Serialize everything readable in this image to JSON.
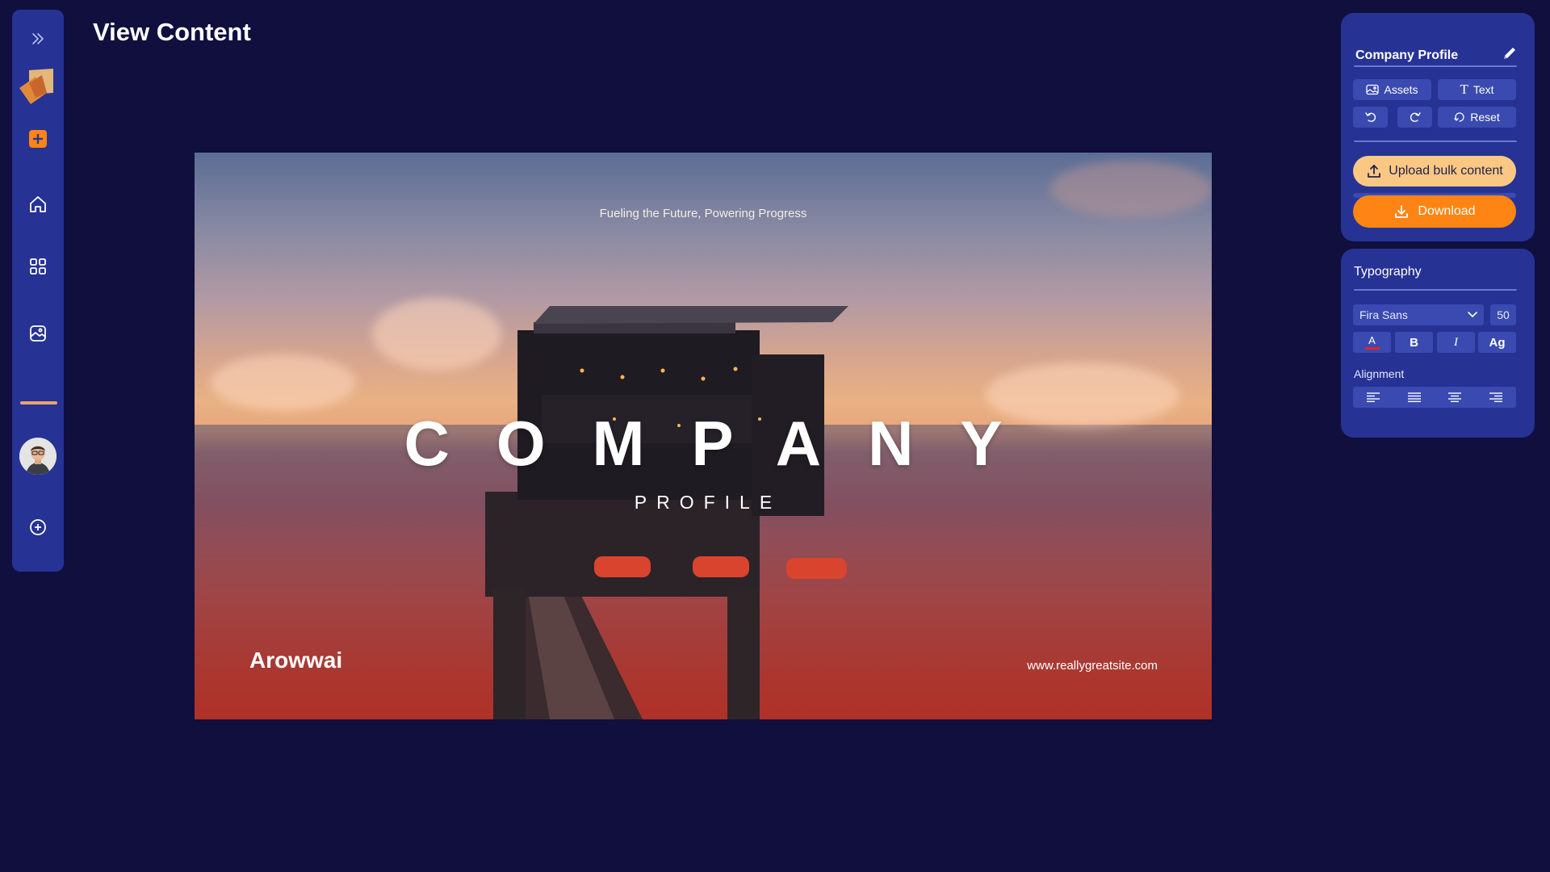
{
  "page": {
    "title": "View Content"
  },
  "sidebar": {
    "items": [
      {
        "name": "expand",
        "icon": "double-chevron-right-icon"
      },
      {
        "name": "logo",
        "icon": "app-logo"
      },
      {
        "name": "add",
        "icon": "plus-square-icon"
      },
      {
        "name": "home",
        "icon": "home-icon"
      },
      {
        "name": "dashboard",
        "icon": "grid-icon"
      },
      {
        "name": "gallery",
        "icon": "image-icon"
      },
      {
        "name": "profile",
        "icon": "avatar"
      },
      {
        "name": "new",
        "icon": "plus-circle-icon"
      }
    ]
  },
  "slide": {
    "tagline": "Fueling the Future, Powering Progress",
    "heading": "COMPANY",
    "subheading": "PROFILE",
    "brand": "Arowwai",
    "url": "www.reallygreatsite.com"
  },
  "profile_panel": {
    "title": "Company Profile",
    "assets_label": "Assets",
    "text_label": "Text",
    "reset_label": "Reset",
    "upload_label": "Upload bulk content",
    "download_label": "Download"
  },
  "typography_panel": {
    "title": "Typography",
    "font_family": "Fira Sans",
    "font_size": "50",
    "color_label": "A",
    "bold_label": "B",
    "italic_label": "I",
    "case_label": "Ag",
    "alignment_label": "Alignment"
  },
  "colors": {
    "background": "#100f3e",
    "panel": "#263294",
    "panel_control": "#3a4ab0",
    "accent_orange": "#fe8514",
    "accent_light_orange": "#fbc883"
  }
}
